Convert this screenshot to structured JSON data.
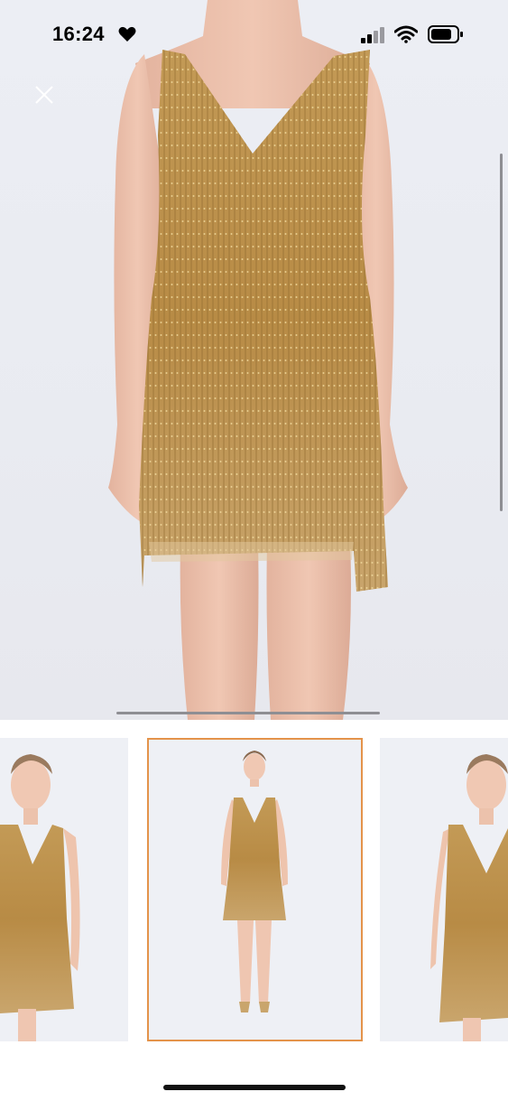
{
  "status_bar": {
    "time": "16:24",
    "icons": [
      "heart-icon",
      "cellular-signal-icon",
      "wifi-icon",
      "battery-icon"
    ]
  },
  "viewer": {
    "close_icon": "close-icon",
    "image_subject": "dress",
    "background_color": "#eaecf2",
    "dress_color": "#b98c48"
  },
  "gallery": {
    "thumbnails": [
      {
        "view": "angled"
      },
      {
        "view": "full-length",
        "selected": true
      },
      {
        "view": "front"
      }
    ],
    "selected_border_color": "#e4934a"
  }
}
